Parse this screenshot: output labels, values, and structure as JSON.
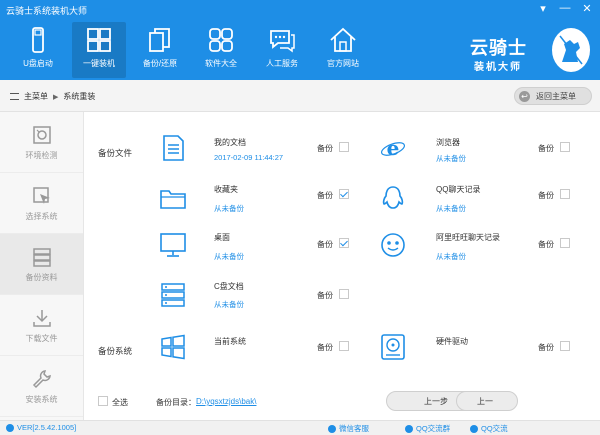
{
  "window": {
    "title": "云骑士系统装机大师",
    "controls": [
      "▾",
      "—",
      "✕"
    ]
  },
  "nav": [
    {
      "label": "U盘启动",
      "icon": "usb-drive-icon"
    },
    {
      "label": "一键装机",
      "icon": "windows-logo-icon",
      "active": true
    },
    {
      "label": "备份/还原",
      "icon": "copy-icon"
    },
    {
      "label": "软件大全",
      "icon": "apps-grid-icon"
    },
    {
      "label": "人工服务",
      "icon": "chat-icon"
    },
    {
      "label": "官方网站",
      "icon": "home-icon"
    }
  ],
  "logo": {
    "title": "云骑士",
    "subtitle": "装机大师"
  },
  "breadcrumb": {
    "root": "主菜单",
    "current": "系统重装"
  },
  "back_button": "返回主菜单",
  "sidebar": [
    {
      "label": "环境检测",
      "icon": "env-check-icon"
    },
    {
      "label": "选择系统",
      "icon": "cursor-select-icon"
    },
    {
      "label": "备份资料",
      "icon": "database-icon",
      "active": true
    },
    {
      "label": "下载文件",
      "icon": "download-icon"
    },
    {
      "label": "安装系统",
      "icon": "wrench-icon"
    }
  ],
  "backup_files": {
    "section_label": "备份文件",
    "backup_label": "备份",
    "items": [
      {
        "name": "我的文档",
        "sub": "2017-02-09 11:44:27",
        "checked": false,
        "icon": "document-icon"
      },
      {
        "name": "浏览器",
        "sub": "从未备份",
        "checked": false,
        "icon": "ie-browser-icon"
      },
      {
        "name": "收藏夹",
        "sub": "从未备份",
        "checked": true,
        "icon": "folder-icon"
      },
      {
        "name": "QQ聊天记录",
        "sub": "从未备份",
        "checked": false,
        "icon": "qq-penguin-icon"
      },
      {
        "name": "桌面",
        "sub": "从未备份",
        "checked": true,
        "icon": "monitor-icon"
      },
      {
        "name": "阿里旺旺聊天记录",
        "sub": "从未备份",
        "checked": false,
        "icon": "wangwang-icon"
      },
      {
        "name": "C盘文档",
        "sub": "从未备份",
        "checked": false,
        "icon": "drive-stack-icon"
      }
    ]
  },
  "backup_system": {
    "section_label": "备份系统",
    "items": [
      {
        "name": "当前系统",
        "checked": false,
        "icon": "windows-logo-icon"
      },
      {
        "name": "硬件驱动",
        "checked": false,
        "icon": "hard-disk-icon"
      }
    ]
  },
  "bottom": {
    "select_all": "全选",
    "dir_label": "备份目录：",
    "dir_path": "D:\\yqsxtzjds\\bak\\",
    "prev_button": "上一步",
    "next_button": "上一"
  },
  "status": {
    "version": "VER[2.5.42.1005]",
    "links": [
      "微信客服",
      "QQ交流群",
      "QQ交流"
    ]
  },
  "colors": {
    "accent": "#1e8ee6"
  }
}
